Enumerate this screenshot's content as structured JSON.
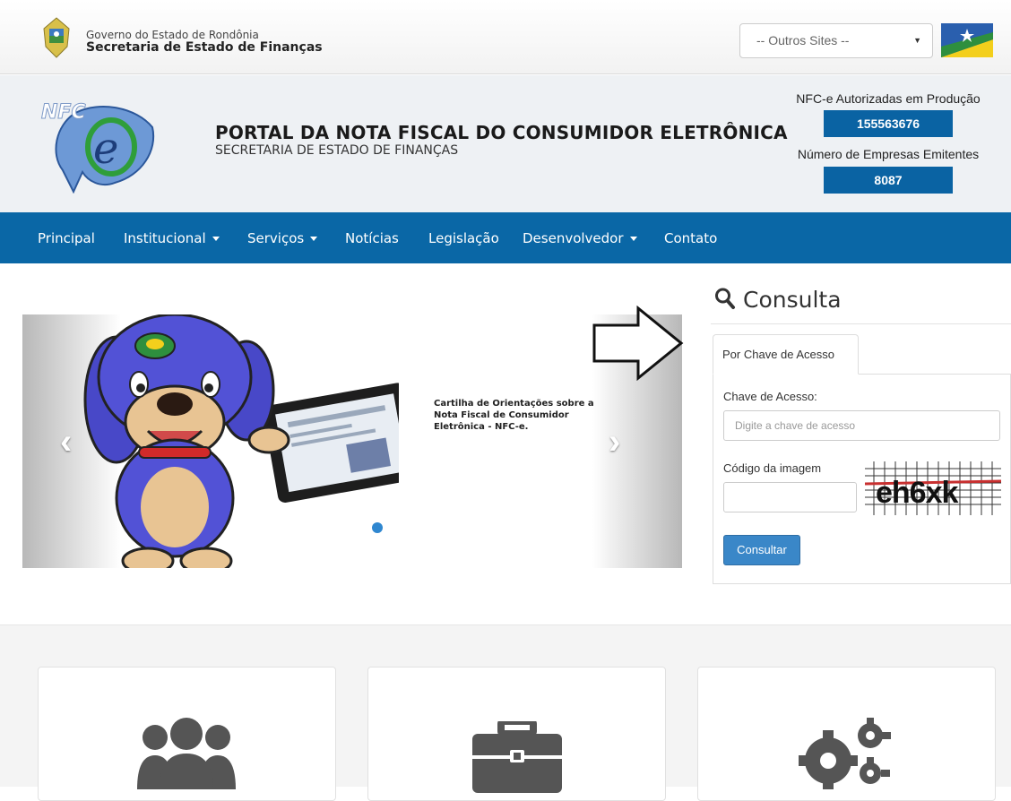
{
  "topbar": {
    "gov_line1": "Governo do Estado de Rondônia",
    "gov_line2": "Secretaria de Estado de Finanças",
    "sites_select_value": "-- Outros Sites --"
  },
  "header": {
    "title": "PORTAL DA NOTA FISCAL DO CONSUMIDOR ELETRÔNICA",
    "subtitle": "SECRETARIA DE ESTADO DE FINANÇAS",
    "stat1_label": "NFC-e Autorizadas em Produção",
    "stat1_value": "155563676",
    "stat2_label": "Número de Empresas Emitentes",
    "stat2_value": "8087"
  },
  "nav": {
    "items": [
      "Principal",
      "Institucional",
      "Serviços",
      "Notícias",
      "Legislação",
      "Desenvolvedor",
      "Contato"
    ]
  },
  "carousel": {
    "caption": "Cartilha de Orientações sobre a Nota Fiscal de Consumidor Eletrônica - NFC-e."
  },
  "consulta": {
    "title": "Consulta",
    "tab_label": "Por Chave de Acesso",
    "chave_label": "Chave de Acesso:",
    "chave_placeholder": "Digite a chave de acesso",
    "codigo_label": "Código da imagem",
    "captcha_text": "eh6xk",
    "button_label": "Consultar"
  },
  "colors": {
    "nav_blue": "#0a67a6",
    "stat_blue": "#0a63a3",
    "button_blue": "#3a87c8"
  }
}
